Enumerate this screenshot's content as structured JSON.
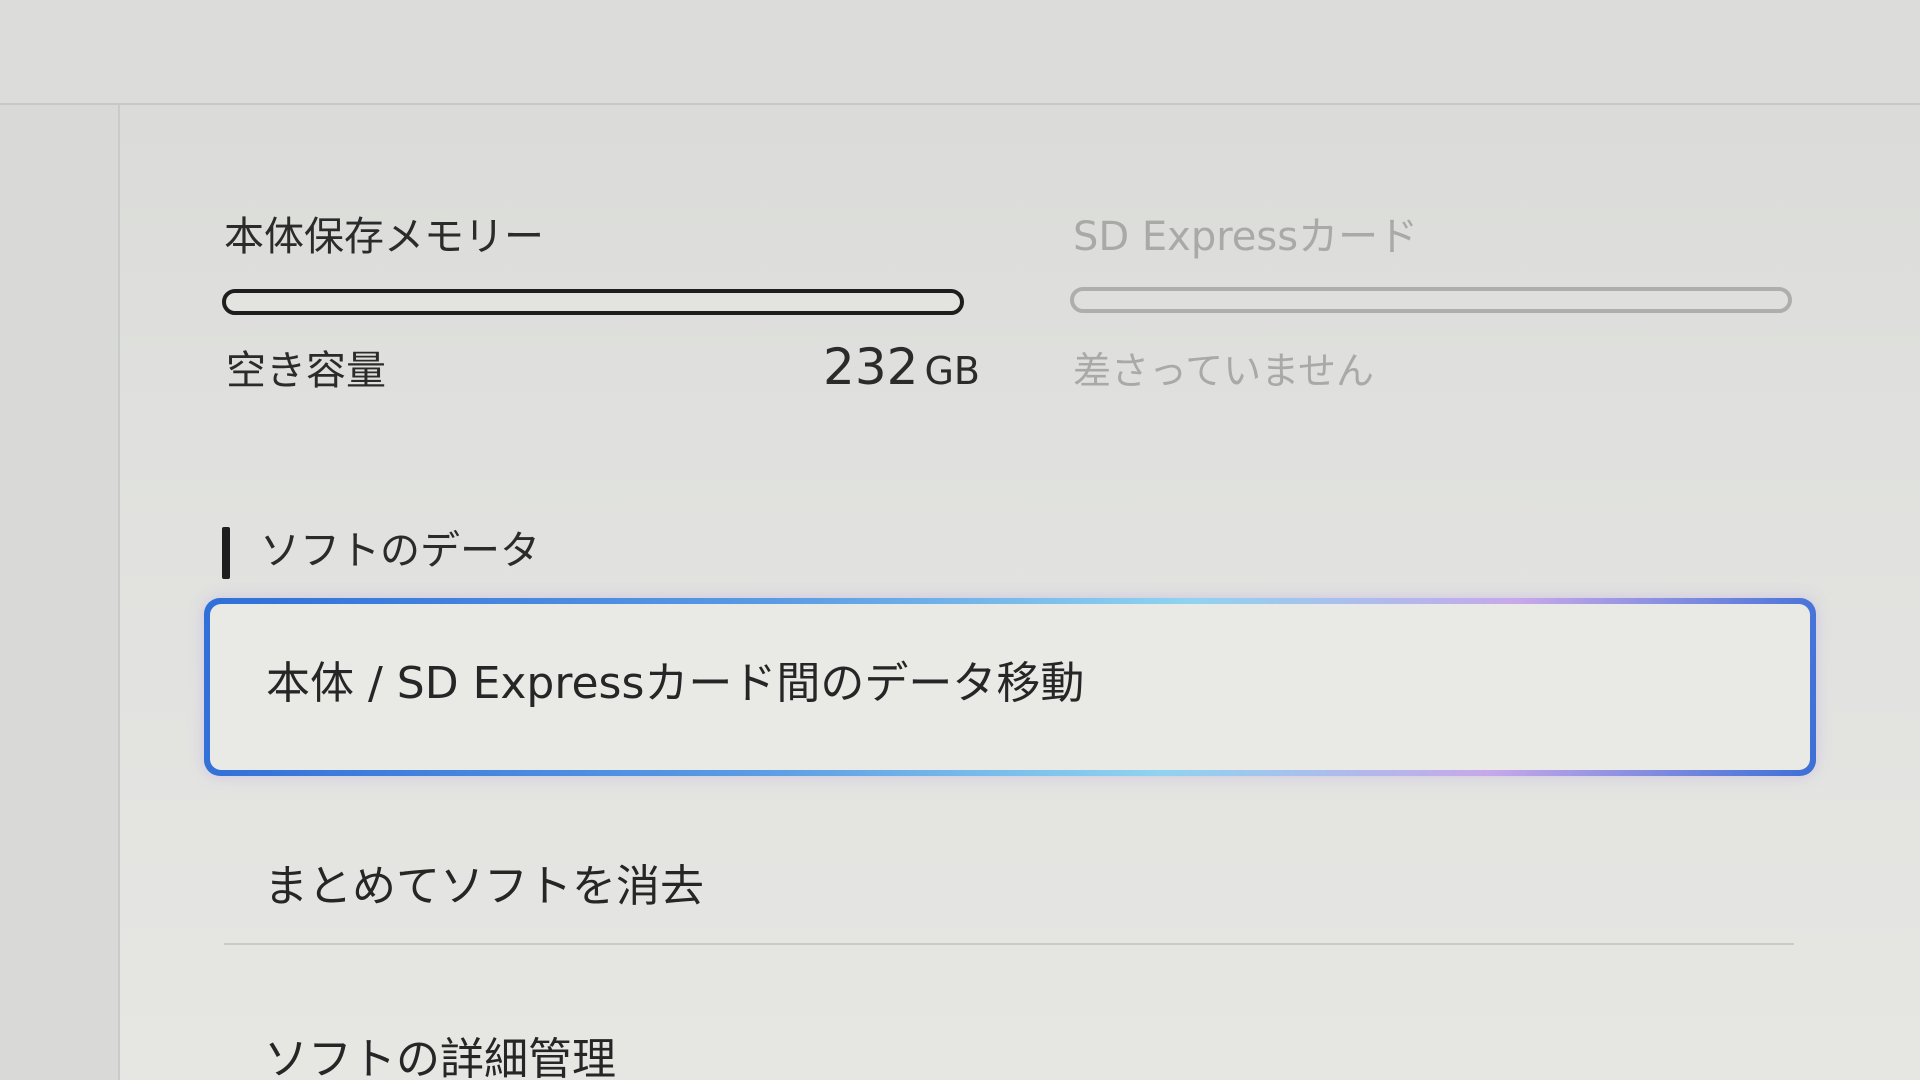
{
  "storage": {
    "internal": {
      "title": "本体保存メモリー",
      "used_fraction": 0.0,
      "free_label": "空き容量",
      "free_value": "232",
      "free_unit": "GB"
    },
    "sd_card": {
      "title": "SD Expressカード",
      "status": "差さっていません"
    }
  },
  "section": {
    "title": "ソフトのデータ"
  },
  "menu": {
    "items": [
      {
        "label": "本体 / SD Expressカード間のデータ移動",
        "selected": true
      },
      {
        "label": "まとめてソフトを消去",
        "selected": false
      },
      {
        "label": "ソフトの詳細管理",
        "selected": false
      }
    ]
  },
  "colors": {
    "focus_start": "#2f6fd8",
    "focus_mid": "#8fd3f0",
    "focus_end": "#c7a8ea",
    "text": "#262626",
    "disabled_text": "#a9aaa8",
    "background": "#e0e1de"
  }
}
